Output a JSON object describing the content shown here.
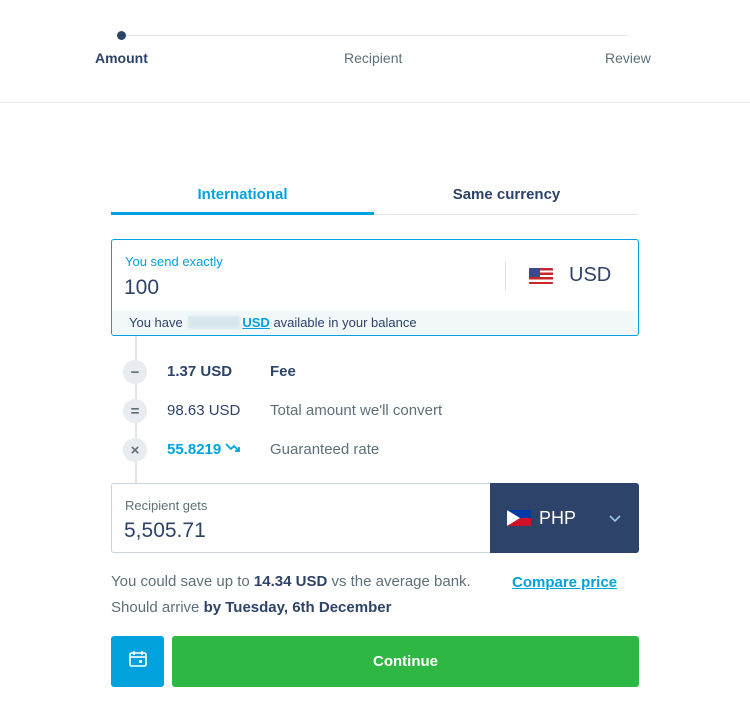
{
  "stepper": {
    "steps": [
      {
        "label": "Amount",
        "active": true
      },
      {
        "label": "Recipient",
        "active": false
      },
      {
        "label": "Review",
        "active": false
      }
    ]
  },
  "tabs": [
    {
      "label": "International",
      "active": true
    },
    {
      "label": "Same currency",
      "active": false
    }
  ],
  "send": {
    "label": "You send exactly",
    "value": "100",
    "currency": "USD",
    "flag_icon": "us-flag-icon",
    "balance_prefix": "You have",
    "balance_currency": "USD",
    "balance_suffix": "available in your balance"
  },
  "breakdown": [
    {
      "operator": "−",
      "value": "1.37 USD",
      "description": "Fee"
    },
    {
      "operator": "=",
      "value": "98.63 USD",
      "description": "Total amount we'll convert"
    },
    {
      "operator": "×",
      "value": "55.8219",
      "description": "Guaranteed rate",
      "icon": "trend-down-icon"
    }
  ],
  "receive": {
    "label": "Recipient gets",
    "value": "5,505.71",
    "currency": "PHP",
    "flag_icon": "ph-flag-icon"
  },
  "savings": {
    "prefix": "You could save up to",
    "amount": "14.34 USD",
    "suffix": "vs the average bank.",
    "link": "Compare price"
  },
  "arrival": {
    "prefix": "Should arrive",
    "date": "by Tuesday, 6th December"
  },
  "actions": {
    "continue_label": "Continue",
    "calendar_icon": "calendar-icon"
  },
  "colors": {
    "accent": "#00a2dd",
    "navy": "#2e4369",
    "success": "#2eb843"
  }
}
